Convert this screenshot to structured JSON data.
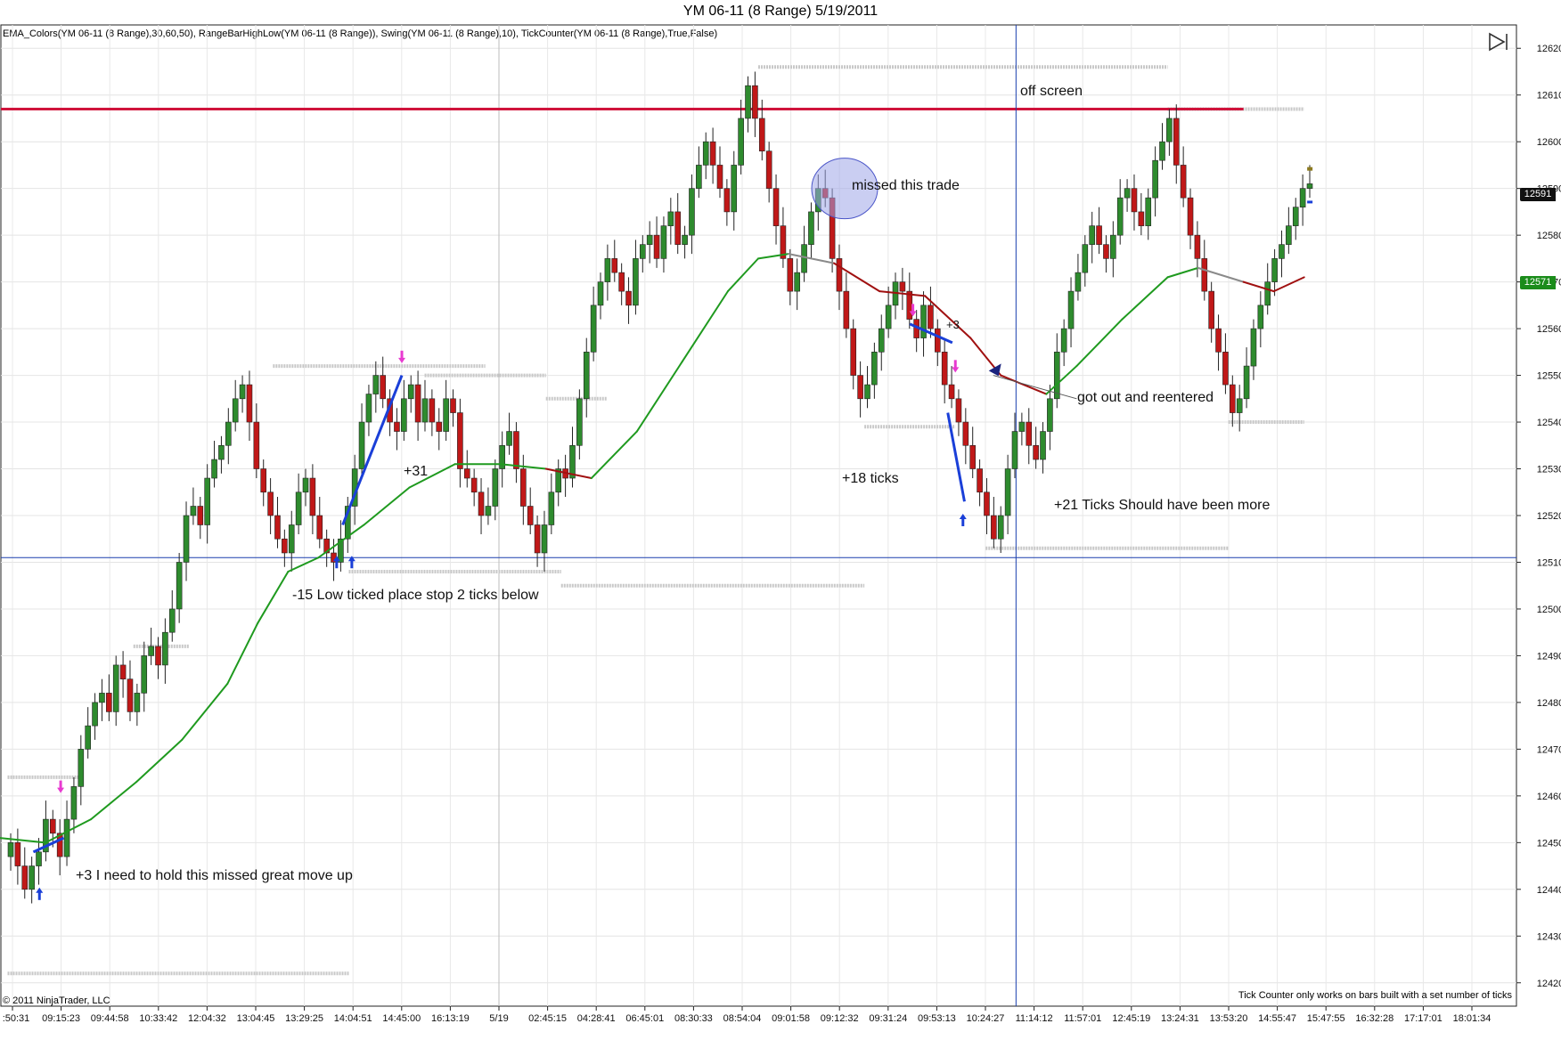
{
  "window": {
    "title": "YM 06-11 (8 Range)  5/19/2011"
  },
  "indicators_label": "EMA_Colors(YM 06-11 (8 Range),30,60,50), RangeBarHighLow(YM 06-11 (8 Range)), Swing(YM 06-11 (8 Range),10), TickCounter(YM 06-11 (8 Range),True,False)",
  "footer": {
    "copyright": "© 2011 NinjaTrader, LLC",
    "tick_counter_note": "Tick Counter only works on bars built with a set number of ticks"
  },
  "annotations": {
    "off_screen": "off screen",
    "missed_trade": "missed this trade",
    "plus3_small": "+3",
    "got_out": "got out and reentered",
    "plus31": "+31",
    "plus18": "+18 ticks",
    "plus21": "+21 Ticks Should have been more",
    "minus15": "-15 Low ticked place stop 2 ticks below",
    "plus3_hold": "+3 I need to hold this missed great move up"
  },
  "price_tags": {
    "current": "12591",
    "ema": "12571"
  },
  "colors": {
    "up_bar": "#2e8b2e",
    "down_bar": "#c01818",
    "ema_green": "#1f9a1f",
    "ema_gray": "#8a8a8a",
    "ema_red": "#a01010",
    "resistance": "#d0143c",
    "blue_line": "#1a3fae",
    "swing_level": "#c8c8c8",
    "arrow_up": "#1a3fd8",
    "arrow_down": "#e83ad0"
  },
  "chart_data": {
    "type": "candlestick",
    "instrument": "YM 06-11 (8 Range)",
    "date": "5/19/2011",
    "ylim": [
      12415,
      12625
    ],
    "y_ticks": [
      12420,
      12430,
      12440,
      12450,
      12460,
      12470,
      12480,
      12490,
      12500,
      12510,
      12520,
      12530,
      12540,
      12550,
      12560,
      12570,
      12580,
      12590,
      12600,
      12610,
      12620
    ],
    "x_tick_labels": [
      ":50:31",
      "09:15:23",
      "09:44:58",
      "10:33:42",
      "12:04:32",
      "13:04:45",
      "13:29:25",
      "14:04:51",
      "14:45:00",
      "16:13:19",
      "5/19",
      "02:45:15",
      "04:28:41",
      "06:45:01",
      "08:30:33",
      "08:54:04",
      "09:01:58",
      "09:12:32",
      "09:31:24",
      "09:53:13",
      "10:24:27",
      "11:14:12",
      "11:57:01",
      "12:45:19",
      "13:24:31",
      "13:53:20",
      "14:55:47",
      "15:47:55",
      "16:32:28",
      "17:17:01",
      "18:01:34"
    ],
    "close_path": [
      12450,
      12445,
      12440,
      12445,
      12448,
      12455,
      12452,
      12447,
      12455,
      12462,
      12470,
      12475,
      12480,
      12482,
      12478,
      12488,
      12485,
      12478,
      12482,
      12490,
      12492,
      12488,
      12495,
      12500,
      12510,
      12520,
      12522,
      12518,
      12528,
      12532,
      12535,
      12540,
      12545,
      12548,
      12540,
      12530,
      12525,
      12520,
      12515,
      12512,
      12518,
      12525,
      12528,
      12520,
      12515,
      12512,
      12510,
      12515,
      12522,
      12530,
      12540,
      12546,
      12550,
      12545,
      12540,
      12538,
      12545,
      12548,
      12540,
      12545,
      12540,
      12538,
      12545,
      12542,
      12530,
      12528,
      12525,
      12520,
      12522,
      12530,
      12535,
      12538,
      12530,
      12522,
      12518,
      12512,
      12518,
      12525,
      12530,
      12528,
      12535,
      12545,
      12555,
      12565,
      12570,
      12575,
      12572,
      12568,
      12565,
      12575,
      12578,
      12580,
      12575,
      12582,
      12585,
      12578,
      12580,
      12590,
      12595,
      12600,
      12595,
      12590,
      12585,
      12595,
      12605,
      12612,
      12605,
      12598,
      12590,
      12582,
      12575,
      12568,
      12572,
      12578,
      12585,
      12590,
      12588,
      12575,
      12568,
      12560,
      12550,
      12545,
      12548,
      12555,
      12560,
      12565,
      12570,
      12568,
      12562,
      12558,
      12565,
      12560,
      12555,
      12548,
      12545,
      12540,
      12535,
      12530,
      12525,
      12520,
      12515,
      12520,
      12530,
      12538,
      12540,
      12535,
      12532,
      12538,
      12545,
      12555,
      12560,
      12568,
      12572,
      12578,
      12582,
      12578,
      12575,
      12580,
      12588,
      12590,
      12585,
      12582,
      12588,
      12596,
      12600,
      12605,
      12595,
      12588,
      12580,
      12575,
      12568,
      12560,
      12555,
      12548,
      12542,
      12545,
      12552,
      12560,
      12565,
      12570,
      12575,
      12578,
      12582,
      12586,
      12590,
      12591
    ],
    "ema_line": [
      {
        "x": 0.0,
        "y": 12451
      },
      {
        "x": 0.03,
        "y": 12450
      },
      {
        "x": 0.06,
        "y": 12455
      },
      {
        "x": 0.09,
        "y": 12463
      },
      {
        "x": 0.12,
        "y": 12472
      },
      {
        "x": 0.15,
        "y": 12484
      },
      {
        "x": 0.17,
        "y": 12497
      },
      {
        "x": 0.19,
        "y": 12508
      },
      {
        "x": 0.21,
        "y": 12511
      },
      {
        "x": 0.24,
        "y": 12518
      },
      {
        "x": 0.27,
        "y": 12526
      },
      {
        "x": 0.3,
        "y": 12531
      },
      {
        "x": 0.33,
        "y": 12531
      },
      {
        "x": 0.36,
        "y": 12530
      },
      {
        "x": 0.39,
        "y": 12528
      },
      {
        "x": 0.42,
        "y": 12538
      },
      {
        "x": 0.45,
        "y": 12553
      },
      {
        "x": 0.48,
        "y": 12568
      },
      {
        "x": 0.5,
        "y": 12575
      },
      {
        "x": 0.52,
        "y": 12576
      },
      {
        "x": 0.55,
        "y": 12574
      },
      {
        "x": 0.58,
        "y": 12568
      },
      {
        "x": 0.61,
        "y": 12567
      },
      {
        "x": 0.64,
        "y": 12558
      },
      {
        "x": 0.66,
        "y": 12550
      },
      {
        "x": 0.69,
        "y": 12546
      },
      {
        "x": 0.71,
        "y": 12552
      },
      {
        "x": 0.74,
        "y": 12562
      },
      {
        "x": 0.77,
        "y": 12571
      },
      {
        "x": 0.79,
        "y": 12573
      },
      {
        "x": 0.82,
        "y": 12570
      },
      {
        "x": 0.84,
        "y": 12568
      },
      {
        "x": 0.86,
        "y": 12571
      }
    ],
    "resistance_level": 12607,
    "horizontal_line": 12511,
    "vertical_line_x": 0.67
  }
}
